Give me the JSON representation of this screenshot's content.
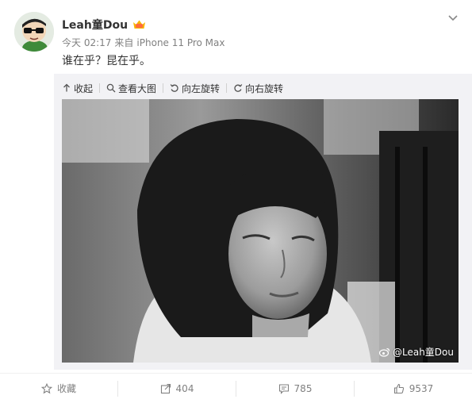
{
  "post": {
    "author": "Leah童Dou",
    "time": "今天 02:17",
    "source_prefix": "来自",
    "source": "iPhone 11 Pro Max",
    "text": "谁在乎？昆在乎。"
  },
  "toolbar": {
    "collapse": "收起",
    "view_large": "查看大图",
    "rotate_left": "向左旋转",
    "rotate_right": "向右旋转"
  },
  "photo": {
    "watermark": "@Leah童Dou"
  },
  "actions": {
    "favorite": "收藏",
    "repost": "404",
    "comment": "785",
    "like": "9537"
  },
  "colors": {
    "accent": "#fa7d3c",
    "muted": "#808080",
    "panel": "#f2f2f5"
  }
}
